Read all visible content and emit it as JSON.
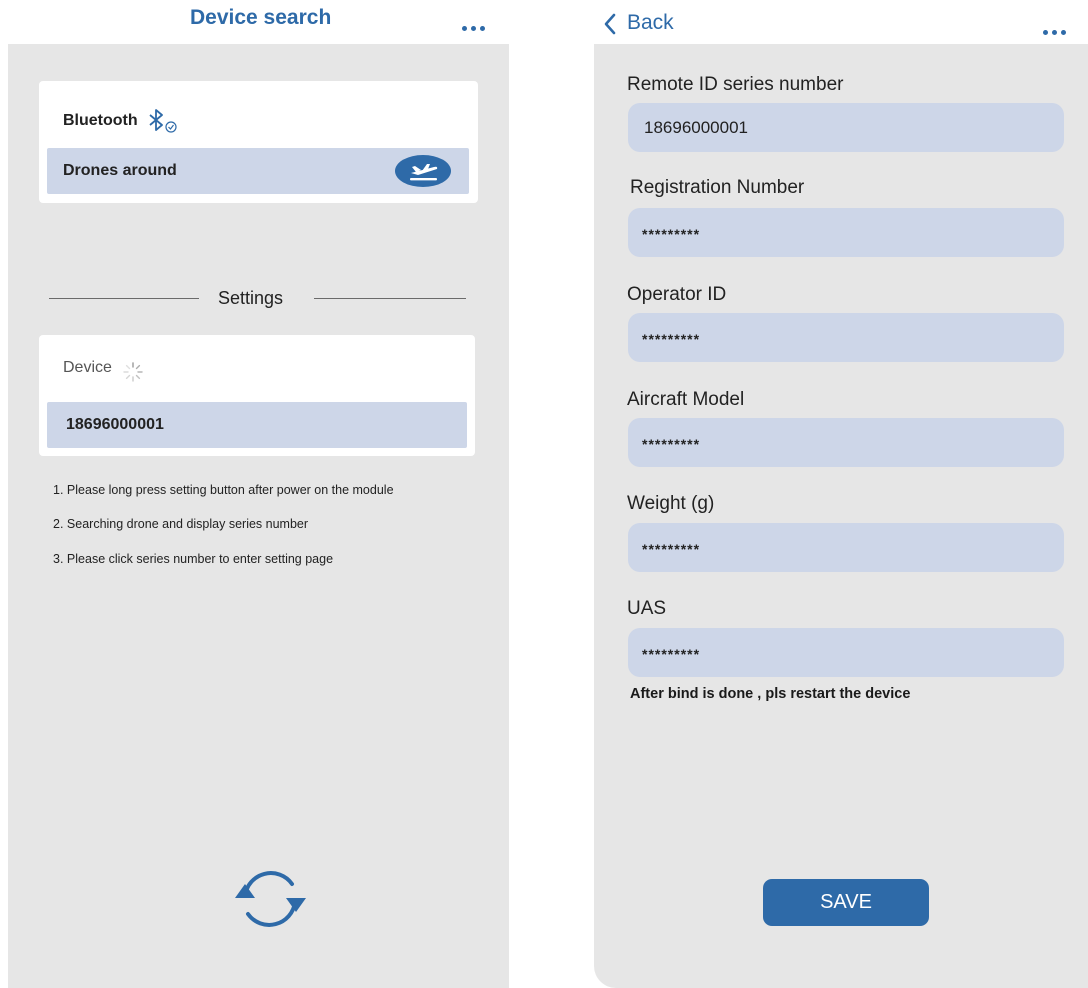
{
  "left": {
    "title": "Device search",
    "bluetooth_label": "Bluetooth",
    "drones_around_label": "Drones around",
    "settings_label": "Settings",
    "device_label": "Device",
    "device_serial": "18696000001",
    "instructions": [
      {
        "num": "1.",
        "text": "Please long press setting button after power on the module"
      },
      {
        "num": "2.",
        "text": "Searching drone and display series number"
      },
      {
        "num": "3.",
        "text": "Please click series number to enter setting page"
      }
    ]
  },
  "right": {
    "back_label": "Back",
    "fields": [
      {
        "label": "Remote ID series number",
        "value": "18696000001"
      },
      {
        "label": "Registration Number",
        "value": "*********"
      },
      {
        "label": "Operator ID",
        "value": "*********"
      },
      {
        "label": "Aircraft Model",
        "value": "*********"
      },
      {
        "label": "Weight (g)",
        "value": "*********"
      },
      {
        "label": "UAS",
        "value": "*********"
      }
    ],
    "note": "After bind is done , pls restart the device",
    "save_label": "SAVE"
  },
  "colors": {
    "accent": "#2e6aa8",
    "field_bg": "#cdd6e8",
    "panel_bg": "#e6e6e6"
  },
  "icons": [
    "bluetooth-icon",
    "airplane-takeoff-icon",
    "loading-spinner-icon",
    "refresh-icon",
    "chevron-left-icon",
    "more-icon"
  ]
}
